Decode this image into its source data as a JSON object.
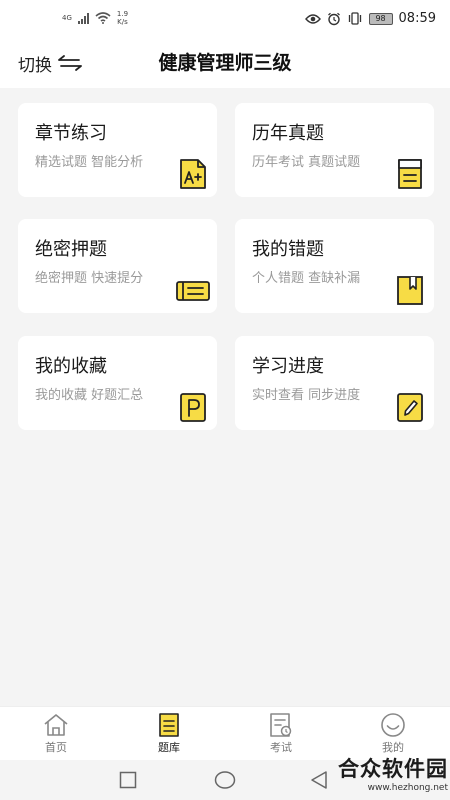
{
  "status_bar": {
    "network": "4G",
    "speed_value": "1.9",
    "speed_unit": "K/s",
    "battery": "98",
    "time": "08:59"
  },
  "header": {
    "switch_label": "切换",
    "title": "健康管理师三级"
  },
  "cards": [
    {
      "title": "章节练习",
      "subtitle": "精选试题 智能分析",
      "icon": "grade-a-plus-icon"
    },
    {
      "title": "历年真题",
      "subtitle": "历年考试 真题试题",
      "icon": "document-icon"
    },
    {
      "title": "绝密押题",
      "subtitle": "绝密押题 快速提分",
      "icon": "ticket-icon"
    },
    {
      "title": "我的错题",
      "subtitle": "个人错题 查缺补漏",
      "icon": "bookmark-book-icon"
    },
    {
      "title": "我的收藏",
      "subtitle": "我的收藏 好题汇总",
      "icon": "p-note-icon"
    },
    {
      "title": "学习进度",
      "subtitle": "实时查看 同步进度",
      "icon": "pencil-note-icon"
    }
  ],
  "bottom_nav": {
    "items": [
      {
        "label": "首页",
        "icon": "home-icon",
        "active": false
      },
      {
        "label": "题库",
        "icon": "question-bank-icon",
        "active": true
      },
      {
        "label": "考试",
        "icon": "exam-icon",
        "active": false
      },
      {
        "label": "我的",
        "icon": "profile-smile-icon",
        "active": false
      }
    ]
  },
  "watermark": {
    "text": "合众软件园",
    "url": "www.hezhong.net"
  },
  "colors": {
    "accent_yellow": "#f7dc45",
    "outline": "#222222",
    "background": "#f4f4f4",
    "card": "#ffffff",
    "subtitle_gray": "#9a9a9a"
  }
}
